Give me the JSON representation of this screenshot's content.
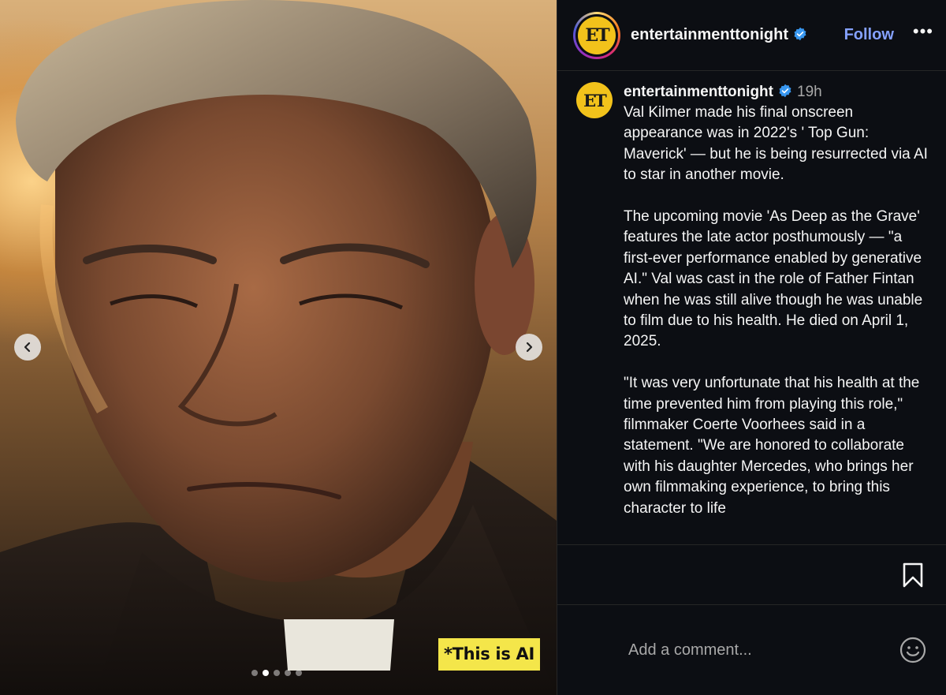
{
  "post": {
    "account": {
      "avatar_text": "ET",
      "username": "entertainmenttonight",
      "verified": true
    },
    "header": {
      "follow_label": "Follow",
      "more_label": "•••"
    },
    "media": {
      "overlay_label": "*This is AI",
      "slide_count": 5,
      "active_slide": 2
    },
    "caption": {
      "username": "entertainmenttonight",
      "time": "19h",
      "paragraphs": [
        "Val Kilmer made his final onscreen appearance was in 2022's ' Top Gun: Maverick' — but he is being resurrected via AI to star in another movie.",
        "The upcoming movie 'As Deep as the Grave' features the late actor posthumously — \"a first-ever performance enabled by generative AI.\" Val was cast in the role of Father Fintan when he was still alive though he was unable to film due to his health. He died on April 1, 2025.",
        "\"It was very unfortunate that his health at the time prevented him from playing this role,\" filmmaker Coerte Voorhees said in a statement. \"We are honored to collaborate with his daughter Mercedes, who brings her own filmmaking experience, to bring this character to life"
      ]
    },
    "comment_box": {
      "placeholder": "Add a comment..."
    }
  },
  "colors": {
    "panel_bg": "#0c0e13",
    "follow": "#85a1ff",
    "verified": "#3897f0",
    "ai_label_bg": "#f4e64a",
    "et_logo": "#f2c21b"
  }
}
